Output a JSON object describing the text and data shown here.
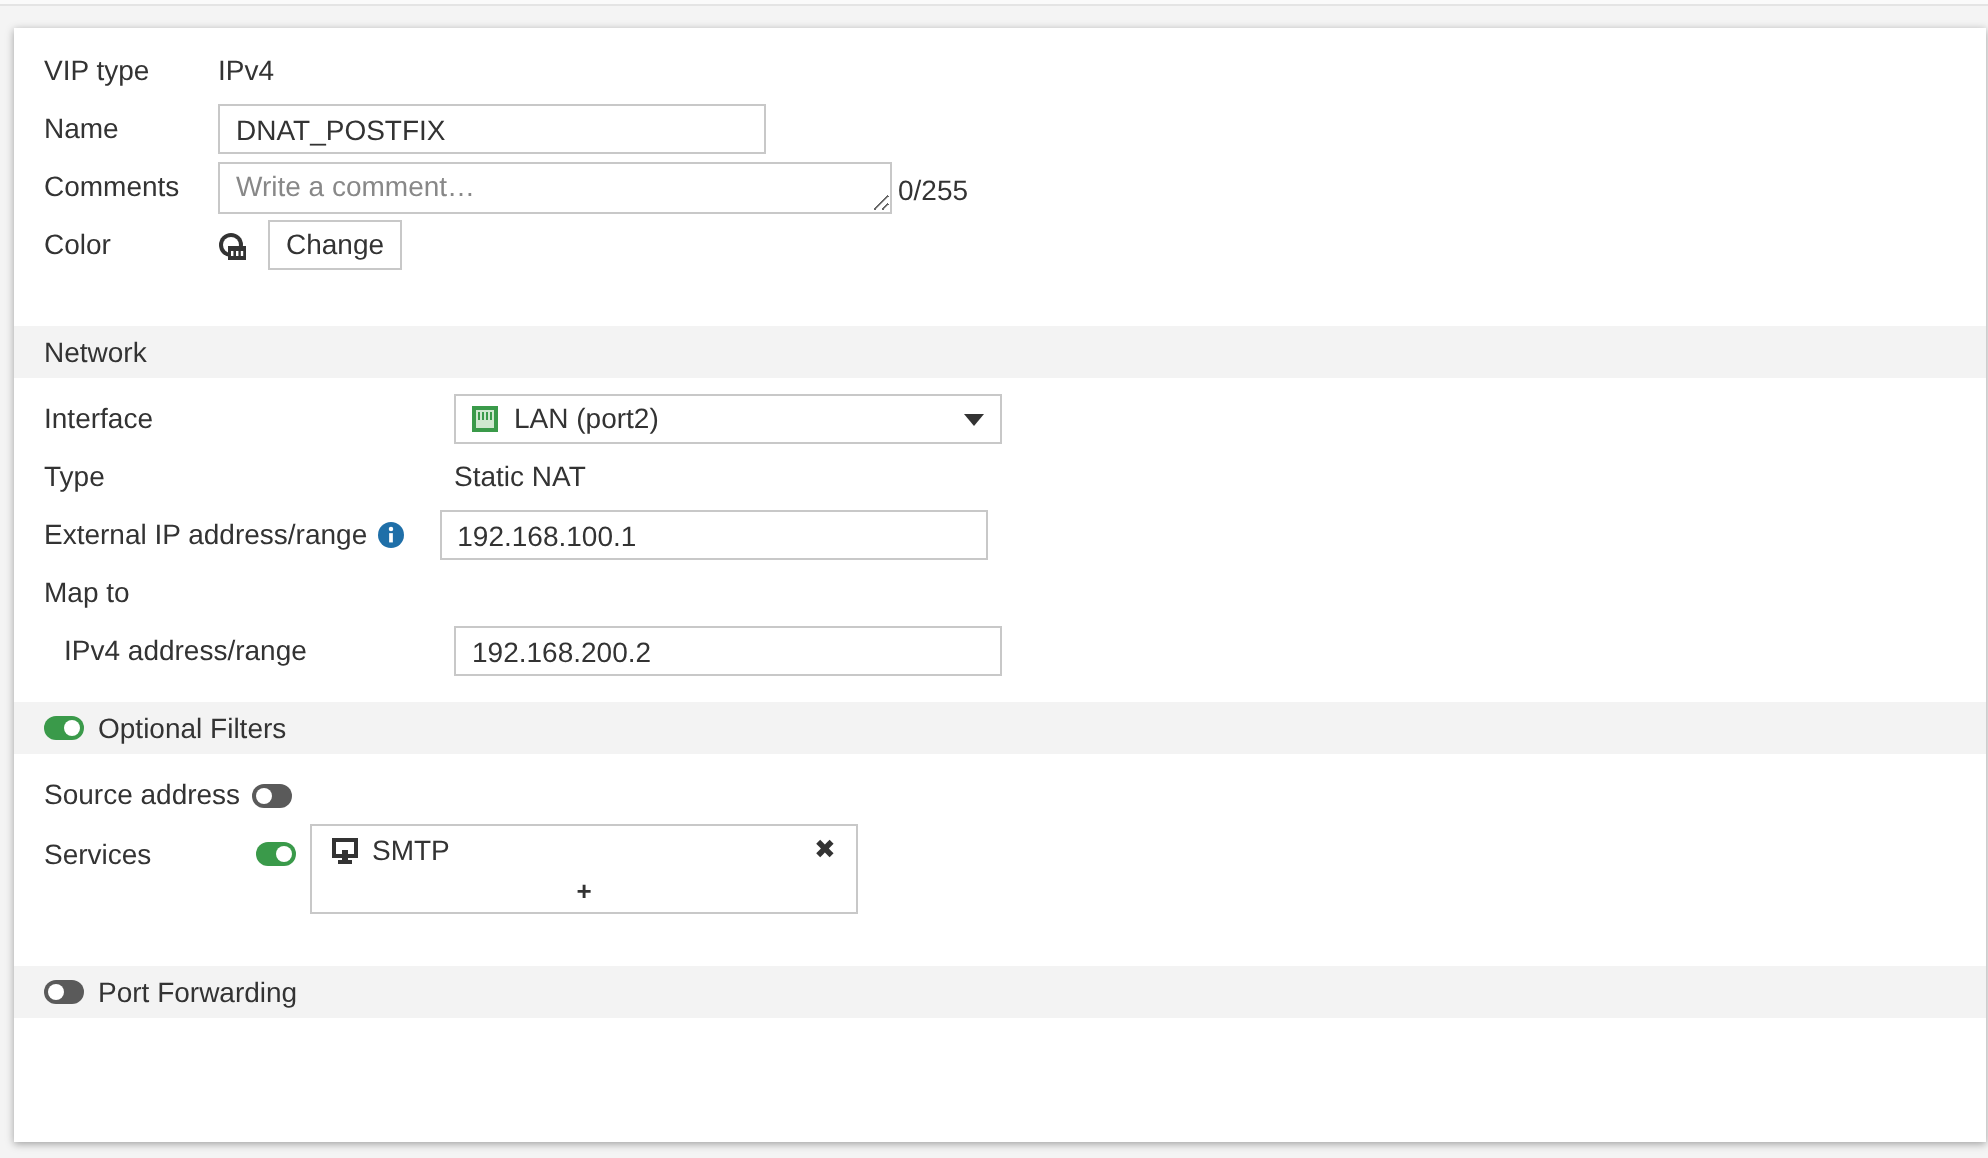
{
  "general": {
    "vip_type_label": "VIP type",
    "vip_type": "IPv4",
    "name_label": "Name",
    "name": "DNAT_POSTFIX",
    "comments_label": "Comments",
    "comments_placeholder": "Write a comment…",
    "comment_count": "0/255",
    "color_label": "Color",
    "change_button": "Change"
  },
  "network": {
    "title": "Network",
    "interface_label": "Interface",
    "interface": "LAN (port2)",
    "type_label": "Type",
    "type": "Static NAT",
    "external_label": "External IP address/range",
    "external": "192.168.100.1",
    "map_label": "Map to",
    "ipv4_label": "IPv4 address/range",
    "ipv4": "192.168.200.2"
  },
  "optional_filters": {
    "title": "Optional Filters",
    "on": true,
    "source_label": "Source address",
    "source_on": false,
    "services_label": "Services",
    "services_on": true,
    "services": [
      {
        "label": "SMTP",
        "remove": "✖"
      }
    ],
    "add": "+"
  },
  "port_forwarding": {
    "title": "Port Forwarding",
    "on": false
  }
}
